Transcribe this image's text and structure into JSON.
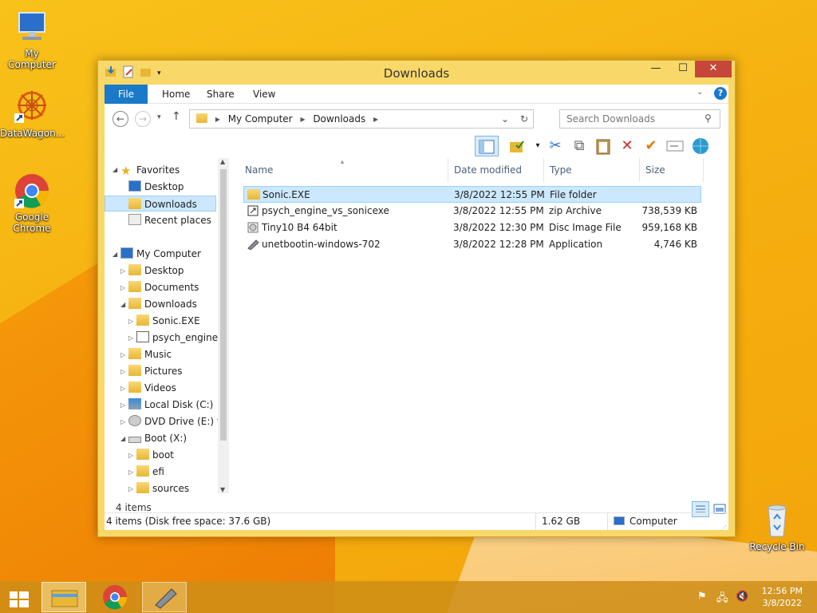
{
  "desktop": {
    "icons": [
      {
        "label": "My Computer"
      },
      {
        "label": "DataWagon..."
      },
      {
        "label": "Google Chrome"
      },
      {
        "label": "Recycle Bin"
      }
    ]
  },
  "window": {
    "title": "Downloads",
    "controls": {
      "minimize": "—",
      "maximize": "☐",
      "close": "✕"
    },
    "ribbon_tabs": [
      "File",
      "Home",
      "Share",
      "View"
    ],
    "address": {
      "segments": [
        "My Computer",
        "Downloads"
      ]
    },
    "search": {
      "placeholder": "Search Downloads"
    },
    "nav": {
      "favorites": {
        "label": "Favorites",
        "items": [
          "Desktop",
          "Downloads",
          "Recent places"
        ]
      },
      "my_computer": {
        "label": "My Computer",
        "items": [
          "Desktop",
          "Documents",
          "Downloads",
          "Sonic.EXE",
          "psych_engine_v",
          "Music",
          "Pictures",
          "Videos",
          "Local Disk (C:)",
          "DVD Drive (E:) tin",
          "Boot (X:)",
          "boot",
          "efi",
          "sources"
        ]
      }
    },
    "columns": [
      "Name",
      "Date modified",
      "Type",
      "Size"
    ],
    "files": [
      {
        "name": "Sonic.EXE",
        "date": "3/8/2022 12:55 PM",
        "type": "File folder",
        "size": ""
      },
      {
        "name": "psych_engine_vs_sonicexe",
        "date": "3/8/2022 12:55 PM",
        "type": "zip Archive",
        "size": "738,539 KB"
      },
      {
        "name": "Tiny10 B4 64bit",
        "date": "3/8/2022 12:30 PM",
        "type": "Disc Image File",
        "size": "959,168 KB"
      },
      {
        "name": "unetbootin-windows-702",
        "date": "3/8/2022 12:28 PM",
        "type": "Application",
        "size": "4,746 KB"
      }
    ],
    "item_count": "4 items",
    "status": {
      "left": "4 items (Disk free space: 37.6 GB)",
      "size": "1.62 GB",
      "location": "Computer"
    }
  },
  "taskbar": {
    "clock": {
      "time": "12:56 PM",
      "date": "3/8/2022"
    }
  },
  "colors": {
    "accent": "#1a79c9",
    "selection": "#cce8ff",
    "window_frame": "#f9d86a",
    "close": "#c7463a"
  }
}
